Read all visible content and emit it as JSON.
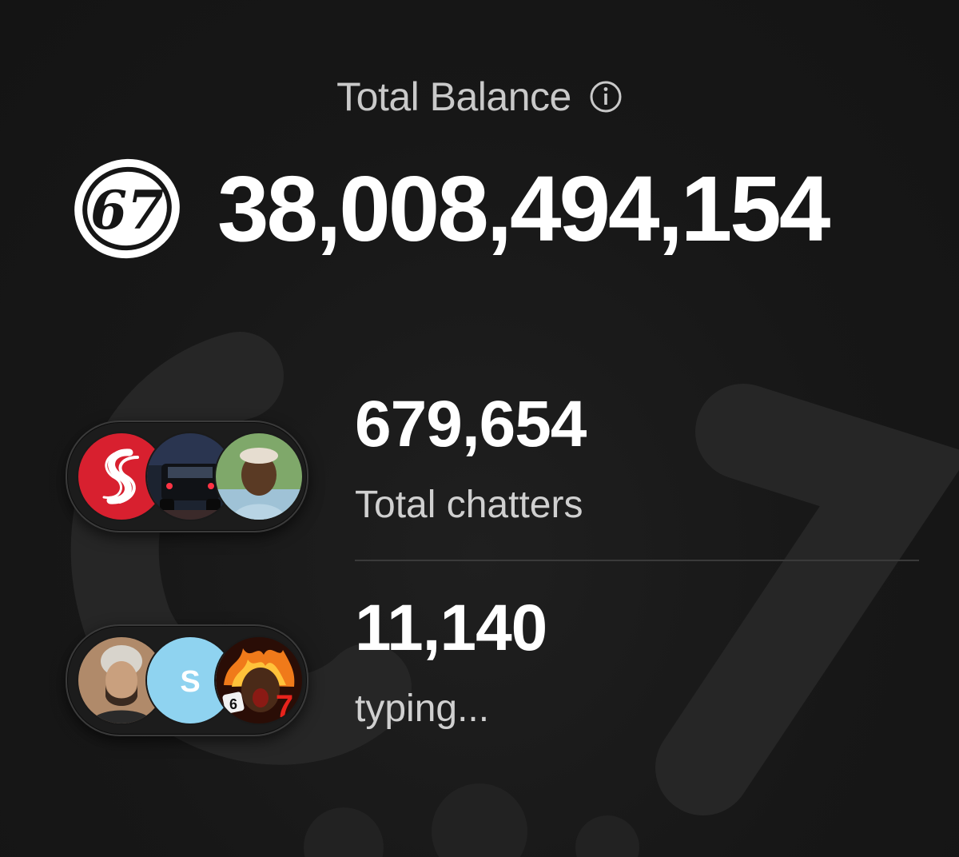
{
  "balance": {
    "label": "Total Balance",
    "value": "38,008,494,154",
    "coin_text": "67",
    "info_icon": "info-icon"
  },
  "stats": [
    {
      "value": "679,654",
      "label": "Total chatters",
      "avatars": [
        "red-logo-avatar",
        "car-photo-avatar",
        "boy-photo-avatar"
      ]
    },
    {
      "value": "11,140",
      "label": "typing...",
      "avatars": [
        "man-photo-avatar",
        "letter-avatar",
        "fire-character-avatar"
      ],
      "letter_avatar_text": "S",
      "dice_text": "6",
      "seven_text": "7"
    }
  ],
  "colors": {
    "background": "#161616",
    "text": "#ffffff",
    "muted_text": "#c9c9c9",
    "letter_avatar": "#8fd3f0",
    "red_logo": "#d8202f"
  }
}
